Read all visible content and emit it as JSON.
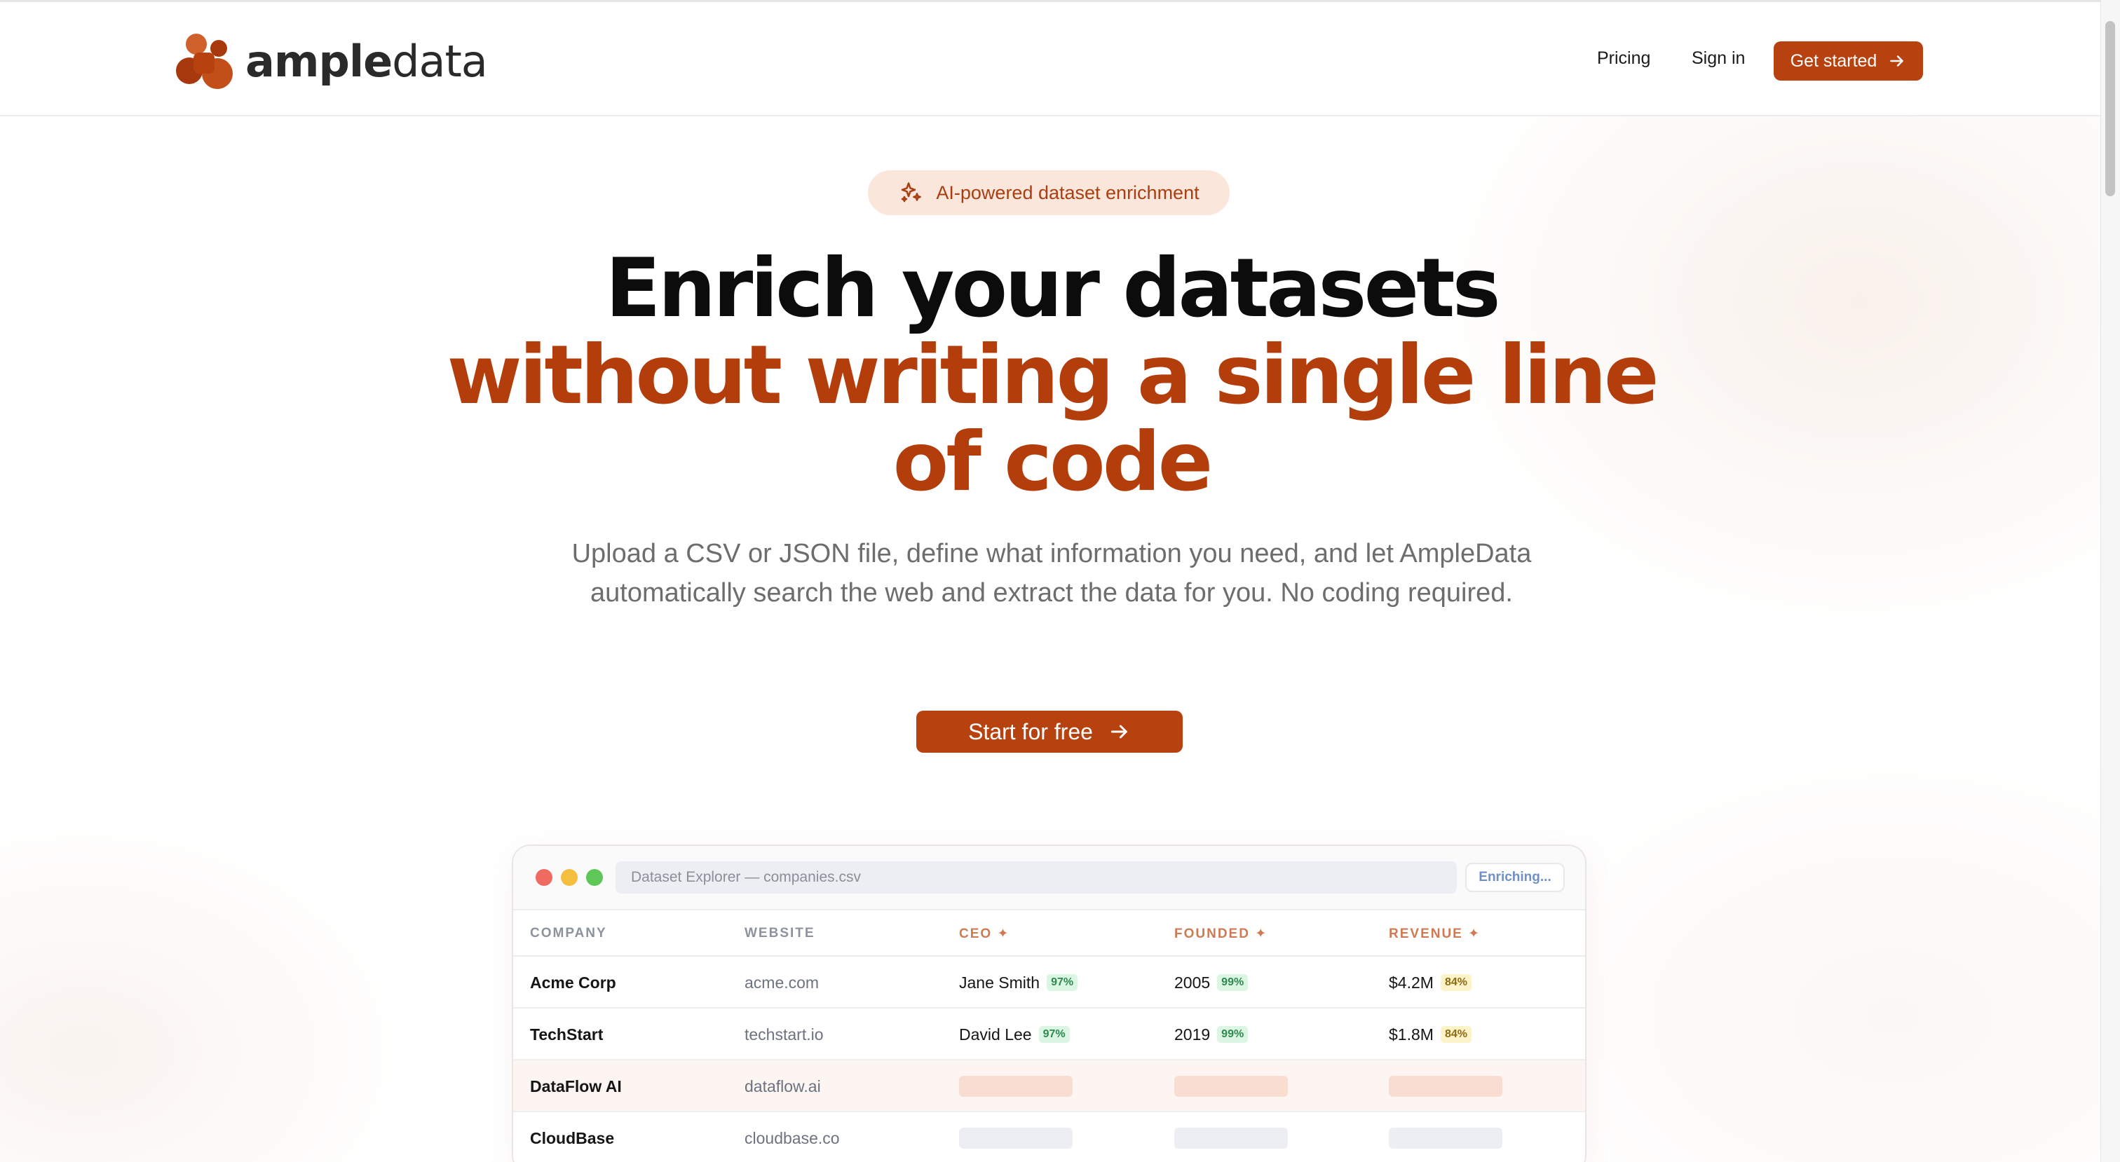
{
  "brand": {
    "name_bold": "ample",
    "name_light": "data",
    "logo_icon": "ampledata-blob-logo",
    "accent_color": "#b8420f"
  },
  "nav": {
    "links": [
      {
        "label": "Pricing"
      },
      {
        "label": "Sign in"
      }
    ],
    "cta_label": "Get started",
    "cta_icon": "arrow-right-icon"
  },
  "hero": {
    "badge": {
      "icon": "sparkles-icon",
      "label": "AI-powered dataset enrichment"
    },
    "headline_line1": "Enrich your datasets",
    "headline_line2": "without writing a single line",
    "headline_line3": "of code",
    "subheadline": "Upload a CSV or JSON file, define what information you need, and let AmpleData automatically search the web and extract the data for you. No coding required.",
    "cta_label": "Start for free",
    "cta_icon": "arrow-right-icon"
  },
  "explorer": {
    "window_title": "Dataset Explorer — companies.csv",
    "status": "Enriching...",
    "columns": [
      {
        "label": "COMPANY",
        "ai": false
      },
      {
        "label": "WEBSITE",
        "ai": false
      },
      {
        "label": "CEO ✦",
        "ai": true
      },
      {
        "label": "FOUNDED ✦",
        "ai": true
      },
      {
        "label": "REVENUE ✦",
        "ai": true
      }
    ],
    "rows": [
      {
        "company": "Acme Corp",
        "website": "acme.com",
        "ceo": "Jane Smith",
        "ceo_conf": "97%",
        "founded": "2005",
        "founded_conf": "99%",
        "revenue": "$4.2M",
        "revenue_conf": "84%"
      },
      {
        "company": "TechStart",
        "website": "techstart.io",
        "ceo": "David Lee",
        "ceo_conf": "97%",
        "founded": "2019",
        "founded_conf": "99%",
        "revenue": "$1.8M",
        "revenue_conf": "84%"
      },
      {
        "company": "DataFlow AI",
        "website": "dataflow.ai",
        "state": "loading"
      },
      {
        "company": "CloudBase",
        "website": "cloudbase.co",
        "state": "pending"
      }
    ]
  }
}
